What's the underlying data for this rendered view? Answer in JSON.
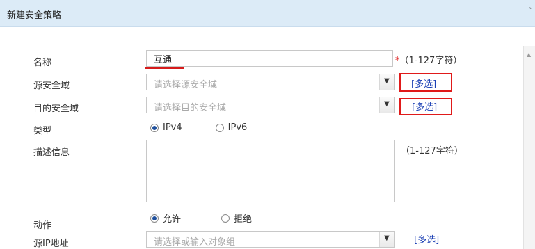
{
  "header": {
    "title": "新建安全策略",
    "caret": "˄"
  },
  "form": {
    "name": {
      "label": "名称",
      "value": "互通",
      "required_mark": "*",
      "hint": "（1-127字符）"
    },
    "source_zone": {
      "label": "源安全域",
      "placeholder": "请选择源安全域",
      "multi": "[多选]"
    },
    "dest_zone": {
      "label": "目的安全域",
      "placeholder": "请选择目的安全域",
      "multi": "[多选]"
    },
    "type": {
      "label": "类型",
      "options": [
        "IPv4",
        "IPv6"
      ],
      "selected": "IPv4"
    },
    "description": {
      "label": "描述信息",
      "hint": "（1-127字符）"
    },
    "action": {
      "label": "动作",
      "options": [
        "允许",
        "拒绝"
      ],
      "selected": "允许"
    },
    "source_ip": {
      "label": "源IP地址",
      "placeholder": "请选择或输入对象组",
      "multi": "[多选]"
    }
  },
  "colors": {
    "header_bg": "#dcebf7",
    "highlight_box": "#e01a1a",
    "link": "#1a3fb4"
  }
}
